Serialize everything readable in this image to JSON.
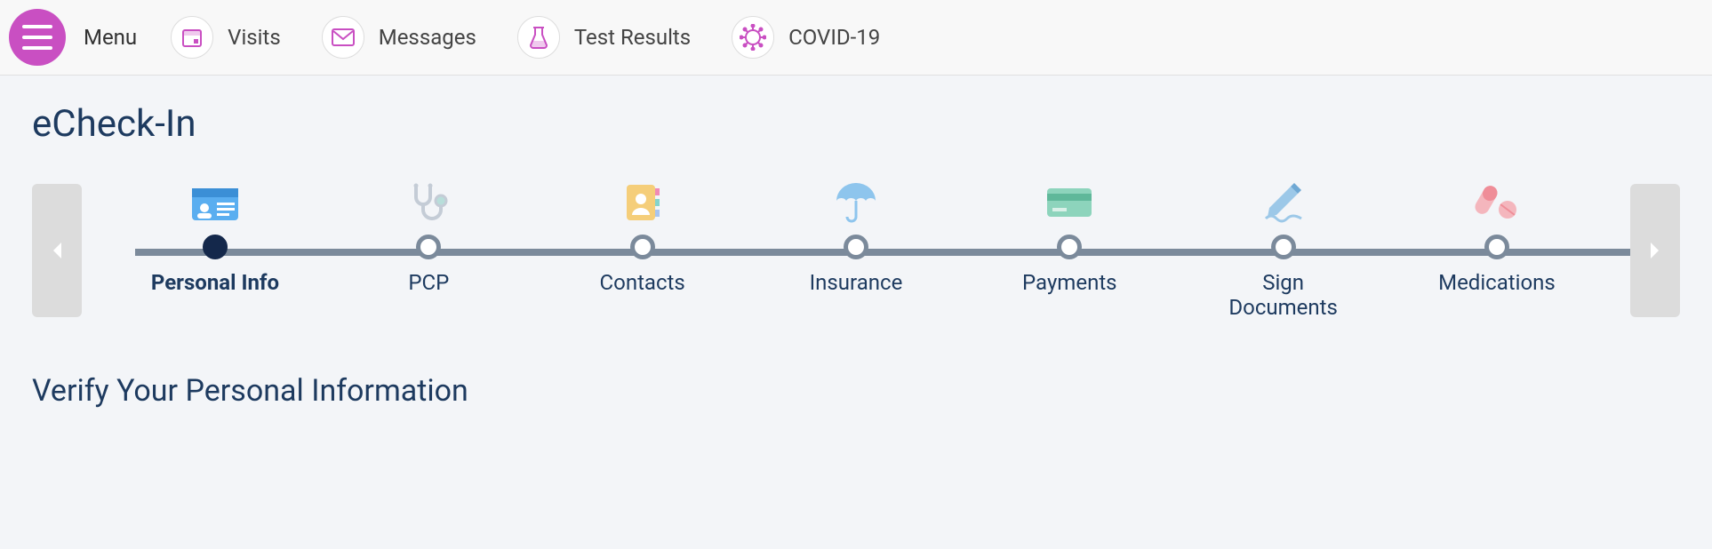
{
  "topnav": {
    "menu_label": "Menu",
    "items": [
      {
        "label": "Visits"
      },
      {
        "label": "Messages"
      },
      {
        "label": "Test Results"
      },
      {
        "label": "COVID-19"
      }
    ]
  },
  "page": {
    "title": "eCheck-In",
    "section_title": "Verify Your Personal Information"
  },
  "stepper": {
    "steps": [
      {
        "label": "Personal Info",
        "active": true
      },
      {
        "label": "PCP",
        "active": false
      },
      {
        "label": "Contacts",
        "active": false
      },
      {
        "label": "Insurance",
        "active": false
      },
      {
        "label": "Payments",
        "active": false
      },
      {
        "label": "Sign Documents",
        "active": false
      },
      {
        "label": "Medications",
        "active": false
      }
    ]
  }
}
